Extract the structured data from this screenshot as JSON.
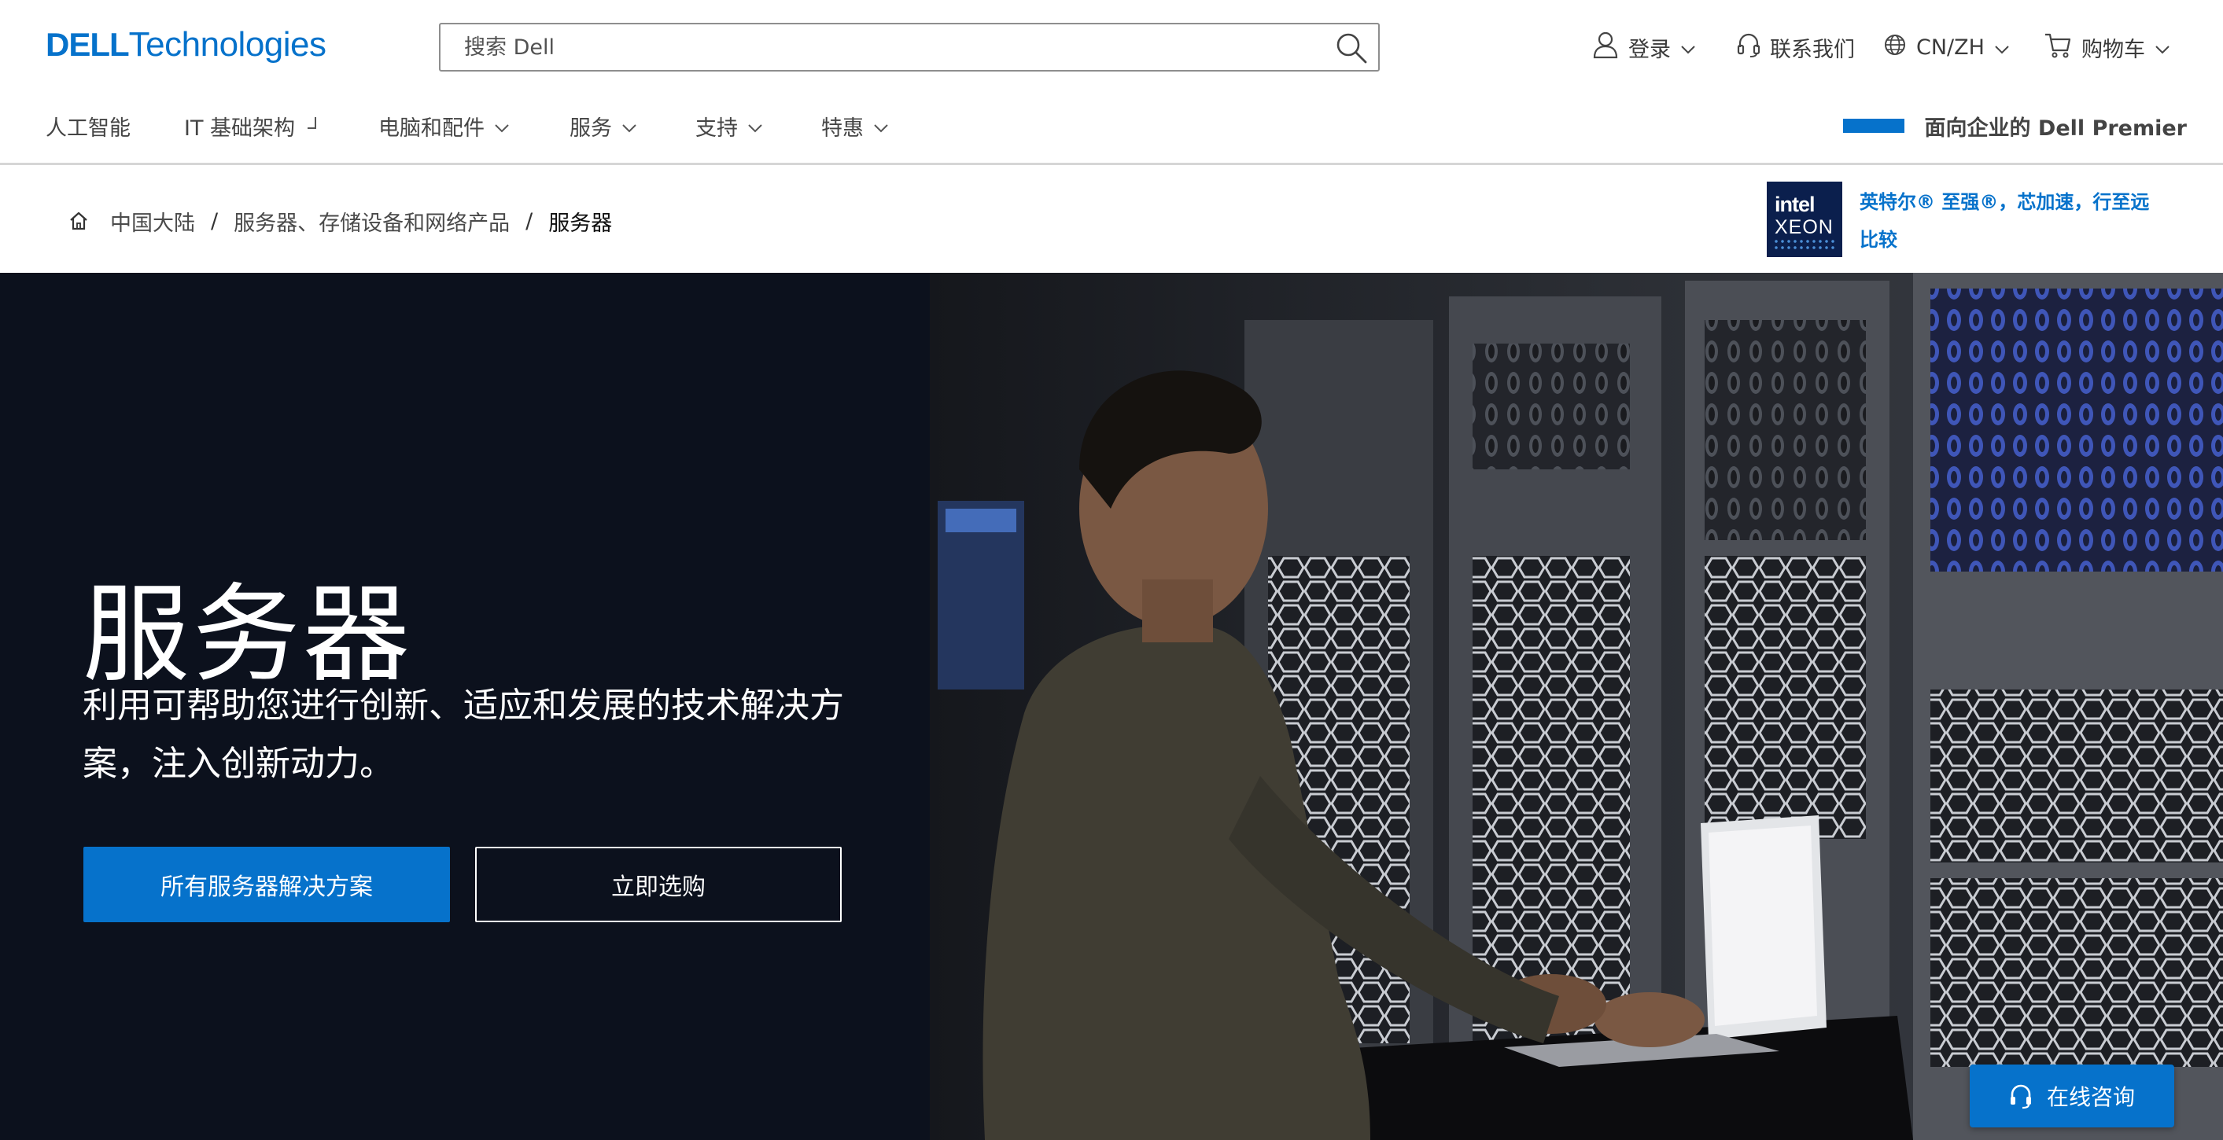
{
  "brand": {
    "part1": "DELL",
    "part2": "Technologies"
  },
  "search": {
    "placeholder": "搜索 Dell"
  },
  "utility": {
    "signin": "登录",
    "contact": "联系我们",
    "locale": "CN/ZH",
    "cart": "购物车"
  },
  "nav": {
    "items": [
      {
        "label": "人工智能"
      },
      {
        "label": "IT 基础架构"
      },
      {
        "label": "电脑和配件"
      },
      {
        "label": "服务"
      },
      {
        "label": "支持"
      },
      {
        "label": "特惠"
      }
    ],
    "premier": "面向企业的 Dell Premier"
  },
  "breadcrumb": {
    "items": [
      "中国大陆",
      "服务器、存储设备和网络产品",
      "服务器"
    ],
    "separator": "/"
  },
  "intel": {
    "badge_line1": "intel",
    "badge_line2": "XEON",
    "link1": "英特尔® 至强®，芯加速，行至远",
    "link2": "比较"
  },
  "hero": {
    "title": "服务器",
    "description": "利用可帮助您进行创新、适应和发展的技术解决方案，注入创新动力。",
    "primary_button": "所有服务器解决方案",
    "secondary_button": "立即选购"
  },
  "chat": {
    "label": "在线咨询"
  },
  "colors": {
    "brand_blue": "#0672cb",
    "hero_background": "#0c111d",
    "intel_navy": "#0b1f4d"
  }
}
